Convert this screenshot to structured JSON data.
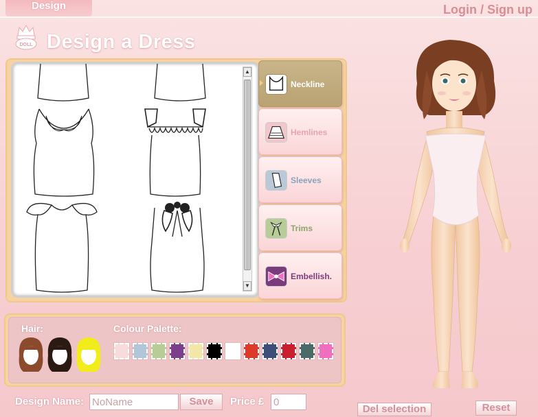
{
  "header": {
    "tab_design": "Design",
    "login": "Login / Sign up",
    "title": "Design a Dress"
  },
  "categories": [
    {
      "label": "Neckline",
      "active": true,
      "color": "#ffffff"
    },
    {
      "label": "Hemlines",
      "active": false,
      "color": "#e7a4ad"
    },
    {
      "label": "Sleeves",
      "active": false,
      "color": "#8aa2b8"
    },
    {
      "label": "Trims",
      "active": false,
      "color": "#8aa66a"
    },
    {
      "label": "Embellish.",
      "active": false,
      "color": "#7b3c7e"
    }
  ],
  "palette": {
    "hair_label": "Hair:",
    "colour_label": "Colour Palette:",
    "hair_colors": [
      "#8b4a2b",
      "#2a1a12",
      "#f2ec1a"
    ],
    "swatches": [
      "#f6dcdc",
      "#b3c6d8",
      "#b8cc98",
      "#7c3f8c",
      "#f4e6a6",
      "#000000",
      "#ffffff",
      "#dc3a2a",
      "#3f4e78",
      "#c81e2e",
      "#4c6a6a",
      "#f06ec0"
    ]
  },
  "footer": {
    "design_name_label": "Design Name:",
    "design_name_value": "NoName",
    "save_label": "Save",
    "price_label": "Price £",
    "price_value": "0",
    "del_label": "Del selection",
    "reset_label": "Reset"
  }
}
